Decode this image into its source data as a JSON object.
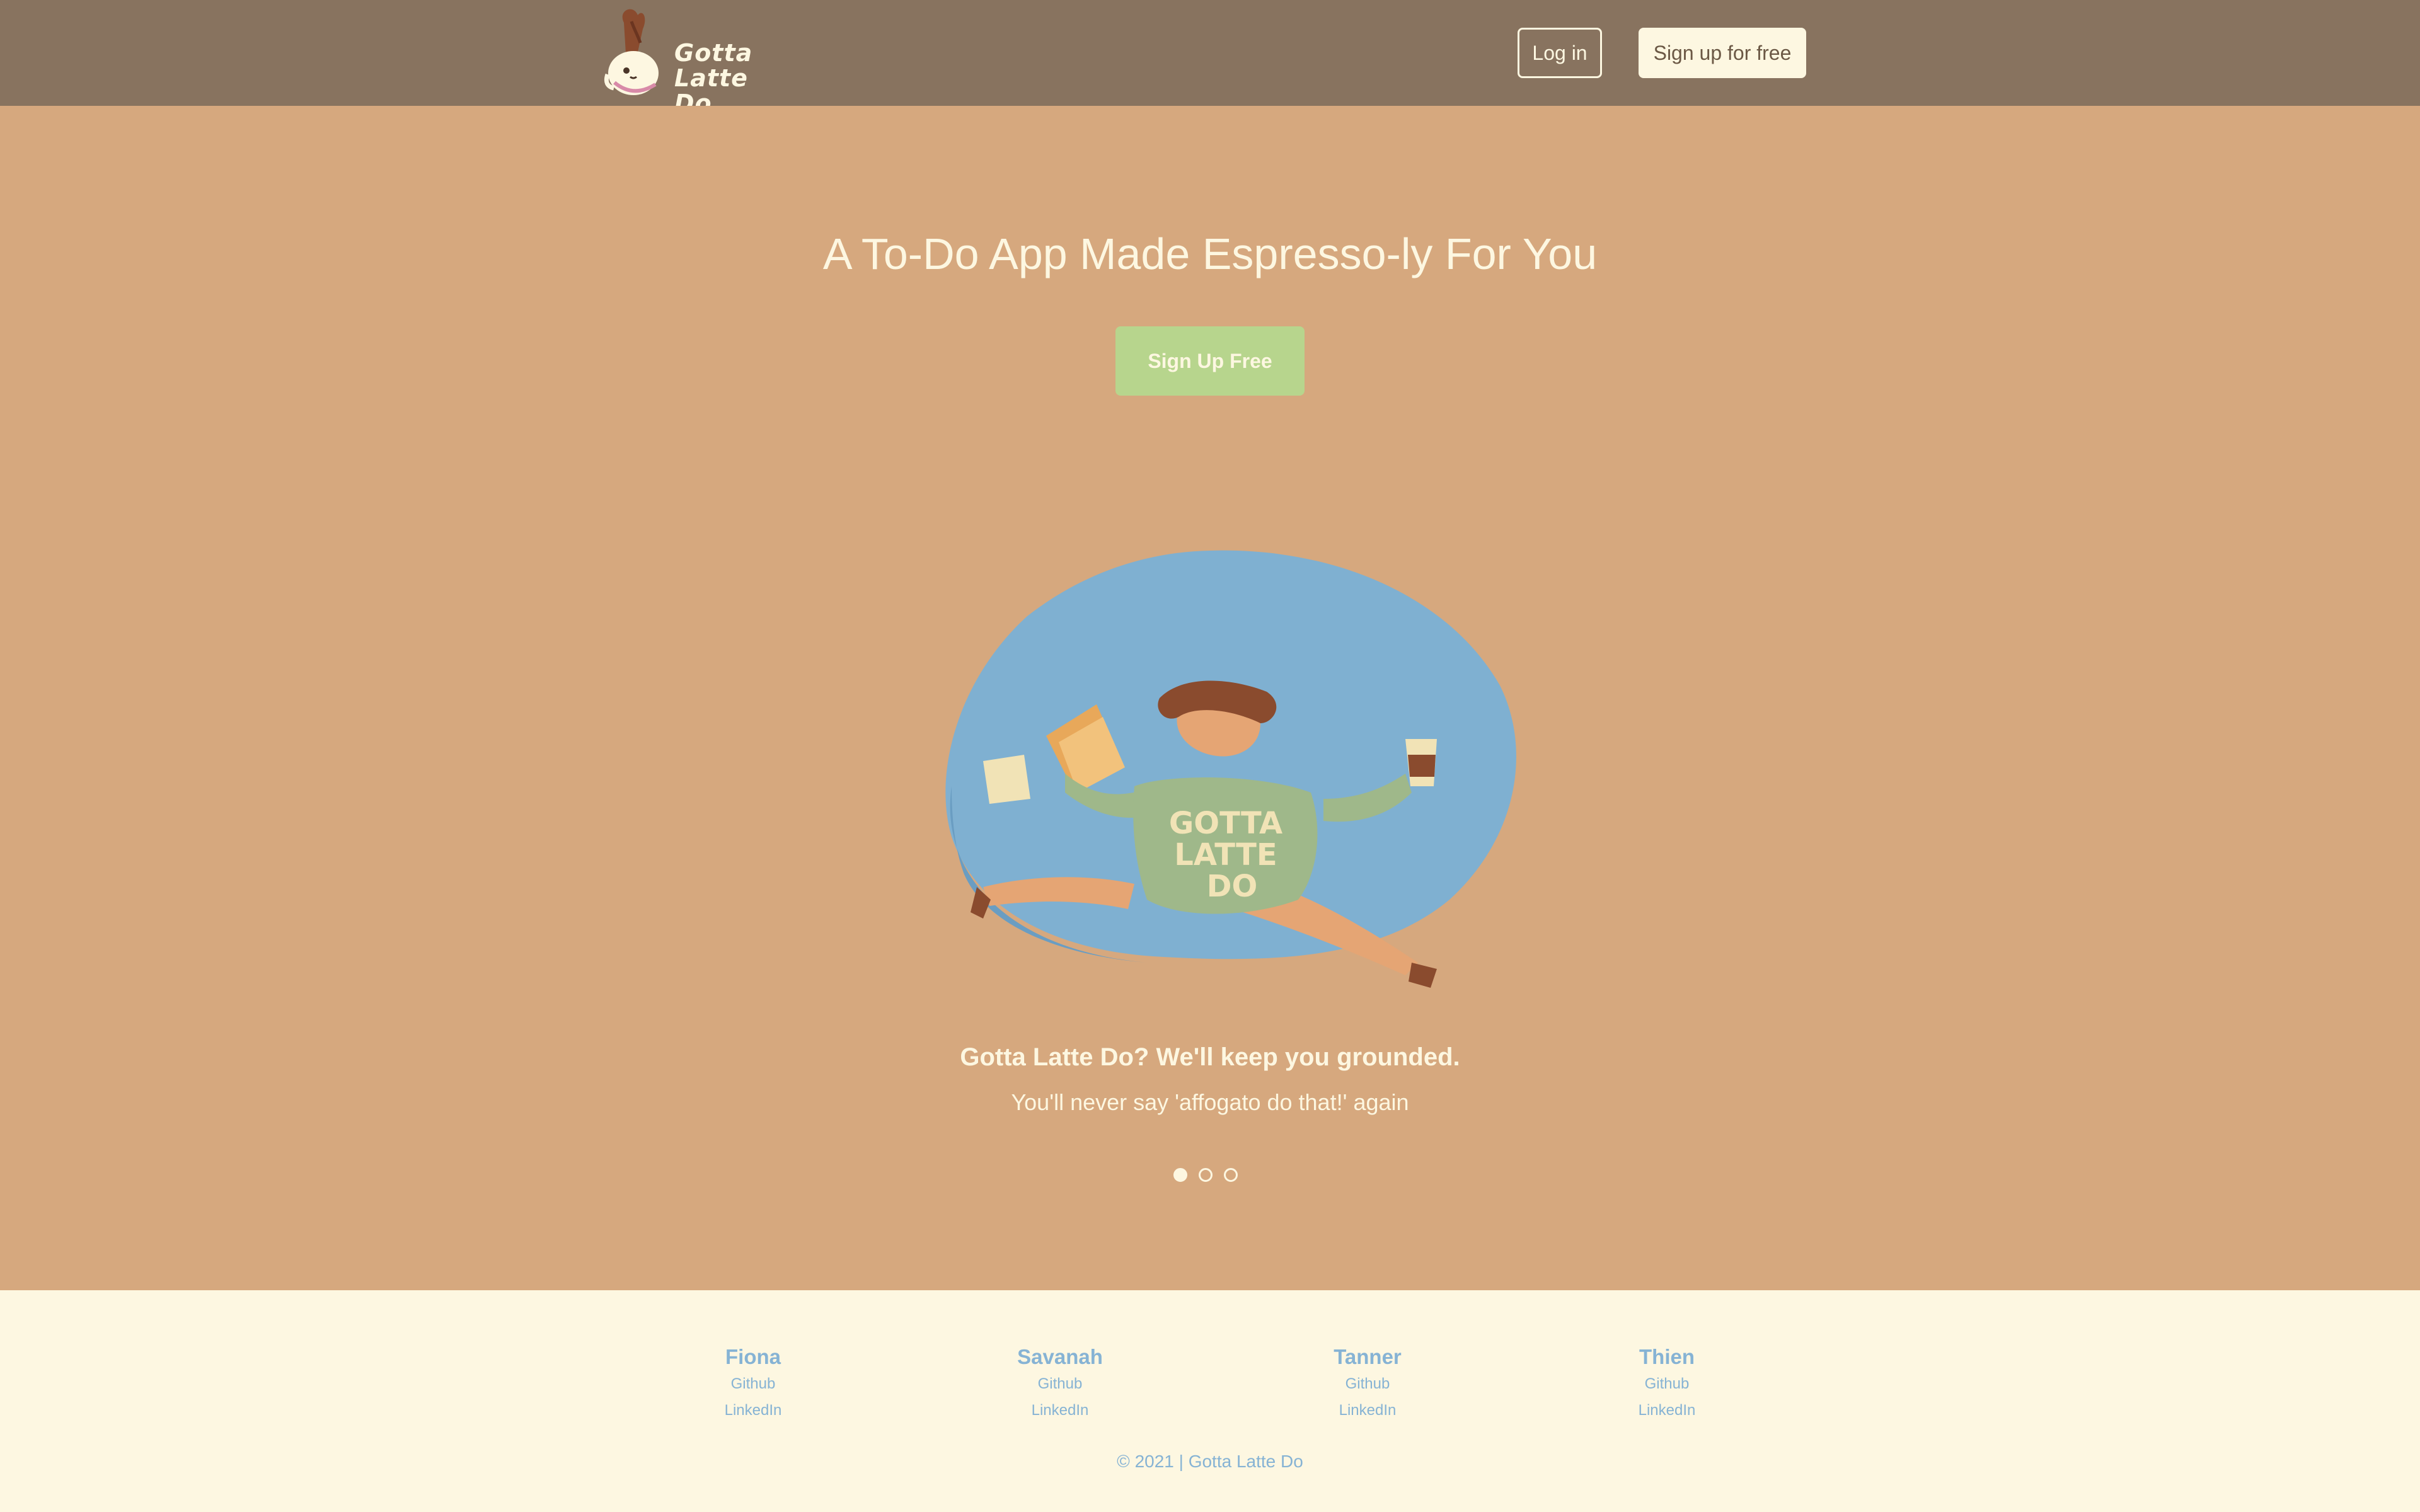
{
  "brand": {
    "line1": "Gotta",
    "line2": "Latte Do",
    "logo_icon": "coffee-cup-mascot-icon"
  },
  "nav": {
    "login_label": "Log in",
    "signup_label": "Sign up for free"
  },
  "hero": {
    "title": "A To-Do App Made Espresso-ly For You",
    "cta_label": "Sign Up Free",
    "illustration": "running-person-with-coffee-illustration",
    "shirt_text": [
      "GOTTA",
      "LATTE",
      "DO"
    ]
  },
  "carousel": {
    "caption_title": "Gotta Latte Do? We'll keep you grounded.",
    "caption_sub": "You'll never say 'affogato do that!' again",
    "slide_count": 3,
    "active_slide": 1
  },
  "footer": {
    "members": [
      {
        "name": "Fiona",
        "github": "Github",
        "linkedin": "LinkedIn"
      },
      {
        "name": "Savanah",
        "github": "Github",
        "linkedin": "LinkedIn"
      },
      {
        "name": "Tanner",
        "github": "Github",
        "linkedin": "LinkedIn"
      },
      {
        "name": "Thien",
        "github": "Github",
        "linkedin": "LinkedIn"
      }
    ],
    "copyright": "© 2021 | Gotta Latte Do"
  },
  "colors": {
    "navbar": "#88735f",
    "hero": "#d6a87e",
    "cream": "#fdf7e1",
    "cta_green": "#b7d58d",
    "link_blue": "#86b3d4",
    "blob_blue": "#7fb0d1"
  }
}
